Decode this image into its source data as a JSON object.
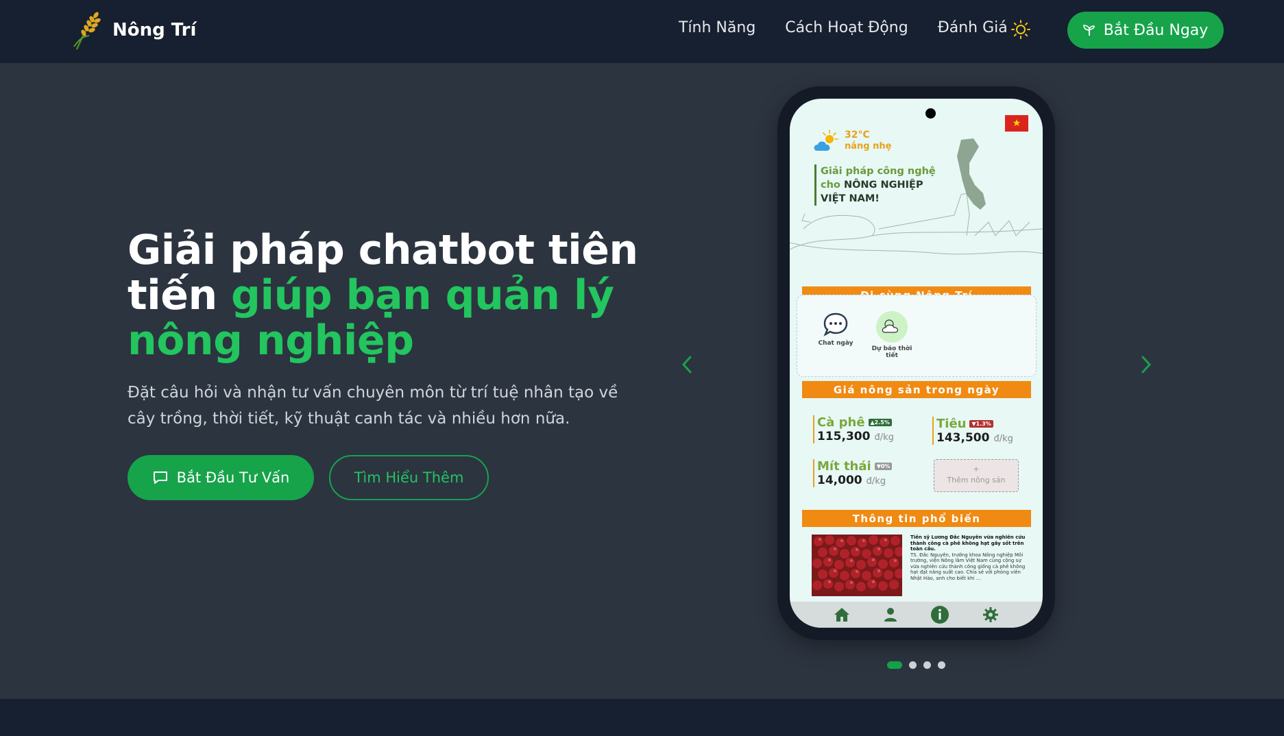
{
  "nav": {
    "brand": "Nông Trí",
    "links": [
      "Tính Năng",
      "Cách Hoạt Động",
      "Đánh Giá"
    ],
    "cta": "Bắt Đầu Ngay"
  },
  "hero": {
    "title_plain": "Giải pháp chatbot tiên tiến ",
    "title_accent": "giúp bạn quản lý nông nghiệp",
    "description": "Đặt câu hỏi và nhận tư vấn chuyên môn từ trí tuệ nhân tạo về cây trồng, thời tiết, kỹ thuật canh tác và nhiều hơn nữa.",
    "primary_button": "Bắt Đầu Tư Vấn",
    "secondary_button": "Tìm Hiểu Thêm"
  },
  "carousel": {
    "slide_count": 4,
    "active_index": 0
  },
  "phone": {
    "weather_temp": "32°C",
    "weather_desc": "nắng nhẹ",
    "slogan_1": "Giải pháp công nghệ",
    "slogan_2a": "cho ",
    "slogan_2b": "NÔNG NGHIỆP",
    "slogan_3": "VIỆT NAM!",
    "section_features": "Đi cùng Nông Trí",
    "features": [
      {
        "label": "Chat ngày",
        "icon": "chat-bubble-icon"
      },
      {
        "label": "Dự báo thời tiết",
        "icon": "weather-icon"
      }
    ],
    "section_prices": "Giá nông sản trong ngày",
    "prices": [
      {
        "name": "Cà phê",
        "badge": "▲2.5%",
        "value": "115,300",
        "unit": "đ/kg"
      },
      {
        "name": "Tiêu",
        "badge": "▼1.3%",
        "value": "143,500",
        "unit": "đ/kg"
      },
      {
        "name": "Mít thái",
        "badge": "▼0%",
        "value": "14,000",
        "unit": "đ/kg"
      }
    ],
    "add_product": "+",
    "add_product_label": "Thêm nông sản",
    "section_news": "Thông tin phổ biến",
    "news_headline": "Tiến sỹ Lương Đắc Nguyên vừa nghiên cứu thành công cà phê không hạt gây sốt trên toàn cầu.",
    "news_body": "TS. Đắc Nguyên, trưởng khoa Nông nghiệp Môi trường, viện Nông lâm Việt Nam cùng cộng sự vừa nghiên cứu thành công giống cà phê không hạt đạt năng suất cao. Chia sẻ với phóng viên Nhật Hào, anh cho biết khi ..."
  },
  "colors": {
    "primary": "#16a34a",
    "accent_text": "#22c55e",
    "nav_bg": "#172030",
    "hero_bg": "#2c3440",
    "orange": "#f08a12"
  }
}
